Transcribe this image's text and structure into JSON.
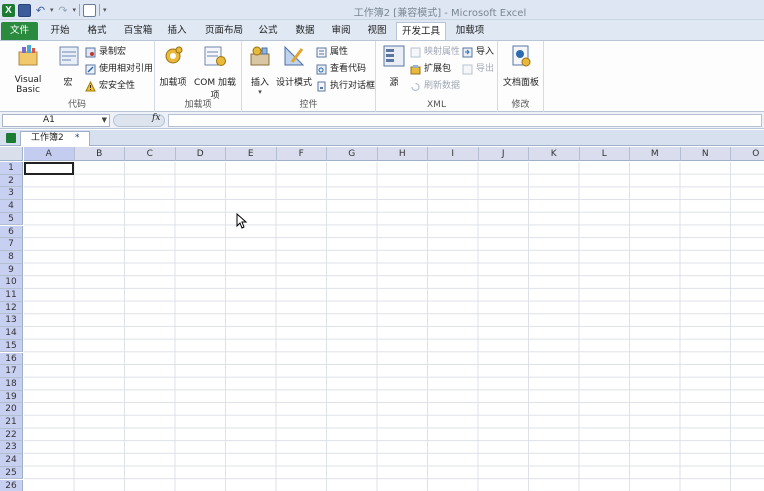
{
  "window": {
    "title": "工作簿2  [兼容模式]  -  Microsoft Excel"
  },
  "qat": {
    "icons": [
      "excel-app-icon",
      "save-icon",
      "undo-icon",
      "redo-icon",
      "print-preview-icon"
    ]
  },
  "tabs": [
    {
      "label": "文件"
    },
    {
      "label": "开始"
    },
    {
      "label": "格式"
    },
    {
      "label": "百宝箱"
    },
    {
      "label": "插入"
    },
    {
      "label": "页面布局"
    },
    {
      "label": "公式"
    },
    {
      "label": "数据"
    },
    {
      "label": "审阅"
    },
    {
      "label": "视图"
    },
    {
      "label": "开发工具"
    },
    {
      "label": "加载项"
    }
  ],
  "active_tab": "开发工具",
  "ribbon": {
    "code": {
      "label": "代码",
      "visual_basic": "Visual Basic",
      "macros": "宏",
      "record_macro": "录制宏",
      "relative_refs": "使用相对引用",
      "macro_security": "宏安全性"
    },
    "addins": {
      "label": "加载项",
      "addins_btn": "加载项",
      "com_addins": "COM 加载项"
    },
    "controls": {
      "label": "控件",
      "insert": "插入",
      "design_mode": "设计模式",
      "properties": "属性",
      "view_code": "查看代码",
      "run_dialog": "执行对话框"
    },
    "xml": {
      "label": "XML",
      "source": "源",
      "map_properties": "映射属性",
      "expansion_packs": "扩展包",
      "refresh_data": "刷新数据",
      "import": "导入",
      "export": "导出"
    },
    "modify": {
      "label": "修改",
      "document_panel": "文档面板"
    }
  },
  "formula_bar": {
    "name_box": "A1",
    "fx": "fx",
    "value": ""
  },
  "workbook_tab": {
    "label": "工作簿2",
    "close": "*"
  },
  "columns": [
    "A",
    "B",
    "C",
    "D",
    "E",
    "F",
    "G",
    "H",
    "I",
    "J",
    "K",
    "L",
    "M",
    "N",
    "O"
  ],
  "rows": [
    "1",
    "2",
    "3",
    "4",
    "5",
    "6",
    "7",
    "8",
    "9",
    "10",
    "11",
    "12",
    "13",
    "14",
    "15",
    "16",
    "17",
    "18",
    "19",
    "20",
    "21",
    "22",
    "23",
    "24",
    "25",
    "26"
  ],
  "colors": {
    "accent": "#2a8a3e",
    "ribbon_bg": "#dfe8f3"
  }
}
